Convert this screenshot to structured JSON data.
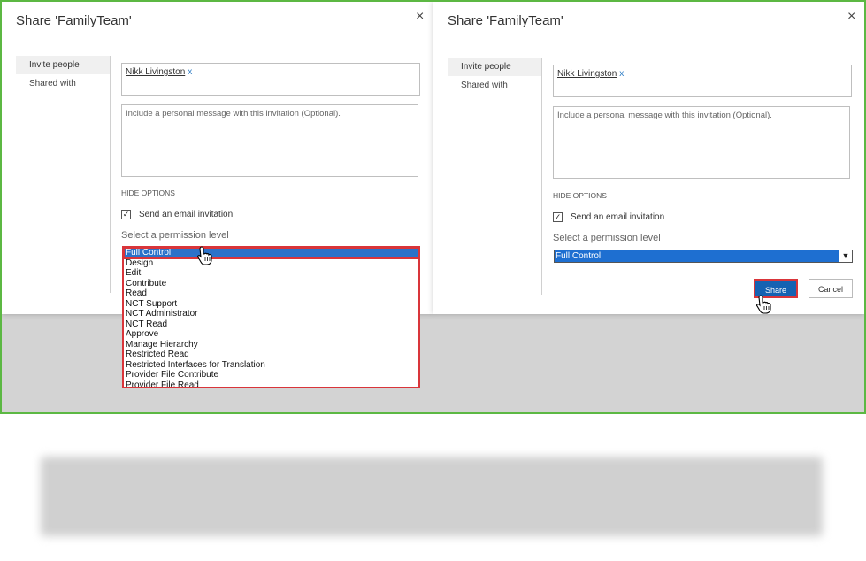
{
  "dialog_left": {
    "title": "Share 'FamilyTeam'",
    "close": "×",
    "nav": [
      "Invite people",
      "Shared with"
    ],
    "person": "Nikk Livingston",
    "person_remove": "x",
    "message_placeholder": "Include a personal message with this invitation (Optional).",
    "hide_options": "HIDE OPTIONS",
    "email_checkbox_label": "Send an email invitation",
    "permission_label": "Select a permission level",
    "permission_options": [
      "Full Control",
      "Design",
      "Edit",
      "Contribute",
      "Read",
      "NCT Support",
      "NCT Administrator",
      "NCT Read",
      "Approve",
      "Manage Hierarchy",
      "Restricted Read",
      "Restricted Interfaces for Translation",
      "Provider File Contribute",
      "Provider File Read"
    ]
  },
  "dialog_right": {
    "title": "Share 'FamilyTeam'",
    "close": "×",
    "nav": [
      "Invite people",
      "Shared with"
    ],
    "person": "Nikk Livingston",
    "person_remove": "x",
    "message_placeholder": "Include a personal message with this invitation (Optional).",
    "hide_options": "HIDE OPTIONS",
    "email_checkbox_label": "Send an email invitation",
    "permission_label": "Select a permission level",
    "selected_permission": "Full Control",
    "share_button": "Share",
    "cancel_button": "Cancel"
  },
  "colors": {
    "frame_border": "#5cb843",
    "highlight_red": "#d9353a",
    "select_blue": "#1e6fd1",
    "share_blue": "#1562b2"
  }
}
